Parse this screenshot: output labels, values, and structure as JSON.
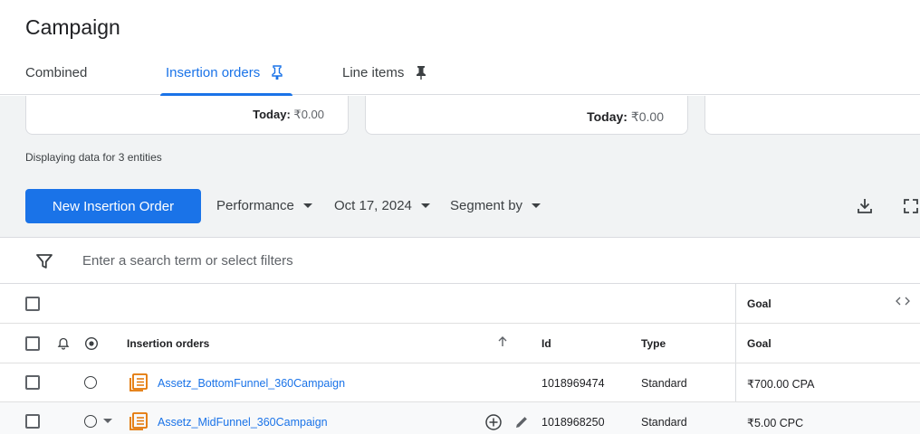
{
  "page": {
    "title": "Campaign"
  },
  "tabs": [
    {
      "label": "Combined"
    },
    {
      "label": "Insertion orders"
    },
    {
      "label": "Line items"
    }
  ],
  "cards": [
    {
      "today_label": "Today:",
      "today_value": "₹0.00"
    },
    {
      "today_label": "Today:",
      "today_value": "₹0.00"
    }
  ],
  "entities_text": "Displaying data for 3 entities",
  "toolbar": {
    "new_button": "New Insertion Order",
    "performance": "Performance",
    "date": "Oct 17, 2024",
    "segment": "Segment by"
  },
  "filter": {
    "placeholder": "Enter a search term or select filters"
  },
  "table": {
    "group_header": "Goal",
    "columns": {
      "name": "Insertion orders",
      "id": "Id",
      "type": "Type",
      "goal": "Goal"
    },
    "rows": [
      {
        "name": "Assetz_BottomFunnel_360Campaign",
        "id": "1018969474",
        "type": "Standard",
        "goal": "₹700.00 CPA"
      },
      {
        "name": "Assetz_MidFunnel_360Campaign",
        "id": "1018968250",
        "type": "Standard",
        "goal": "₹5.00 CPC"
      }
    ]
  },
  "colors": {
    "accent": "#1a73e8",
    "io_icon": "#e37400"
  },
  "icons": [
    "pin-icon",
    "download-icon",
    "fullscreen-icon",
    "filter-icon",
    "bell-icon",
    "target-icon",
    "sort-up-icon",
    "expand-columns-icon",
    "insertion-order-icon",
    "add-circle-icon",
    "edit-icon",
    "caret-down-icon"
  ]
}
